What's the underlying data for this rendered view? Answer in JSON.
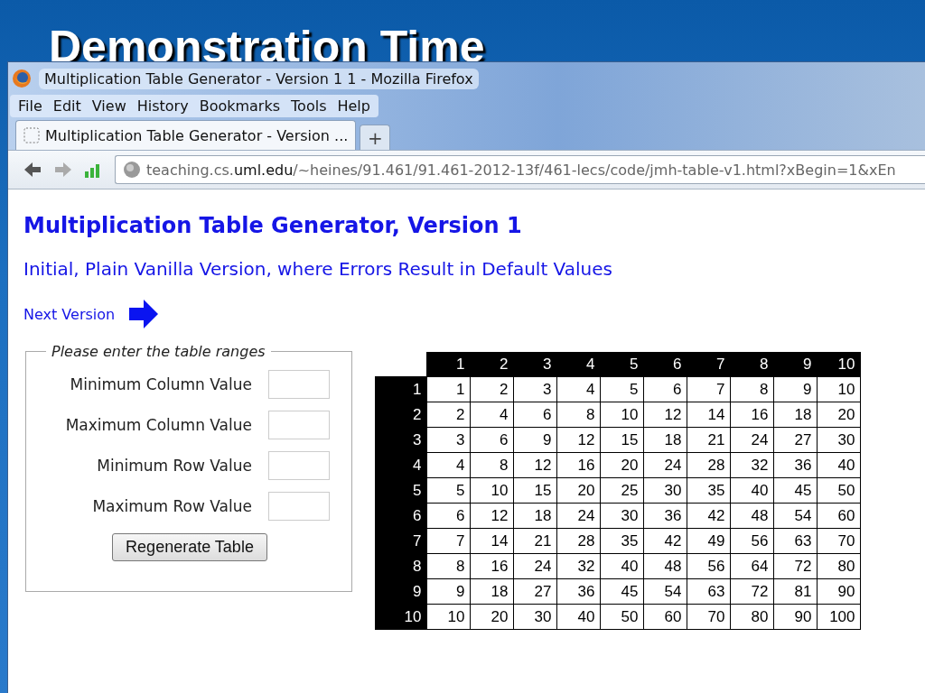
{
  "slide_title": "Demonstration Time",
  "window": {
    "title": "Multiplication Table Generator - Version 1 1 - Mozilla Firefox"
  },
  "menu": [
    "File",
    "Edit",
    "View",
    "History",
    "Bookmarks",
    "Tools",
    "Help"
  ],
  "tabs": [
    {
      "label": "Multiplication Table Generator - Version ...",
      "selected": true
    }
  ],
  "new_tab": "+",
  "address": {
    "pre": "teaching.cs.",
    "host": "uml.edu",
    "path": "/~heines/91.461/91.461-2012-13f/461-lecs/code/jmh-table-v1.html?xBegin=1&xEn"
  },
  "page": {
    "heading": "Multiplication Table Generator, Version 1",
    "subheading": "Initial, Plain Vanilla Version, where Errors Result in Default Values",
    "next_link": "Next Version"
  },
  "form": {
    "legend": "Please enter the table ranges",
    "fields": [
      "Minimum Column Value",
      "Maximum Column Value",
      "Minimum Row Value",
      "Maximum Row Value"
    ],
    "button": "Regenerate Table"
  },
  "table": {
    "columns": [
      "1",
      "2",
      "3",
      "4",
      "5",
      "6",
      "7",
      "8",
      "9",
      "10"
    ],
    "rows": [
      {
        "label": "1",
        "cells": [
          "1",
          "2",
          "3",
          "4",
          "5",
          "6",
          "7",
          "8",
          "9",
          "10"
        ]
      },
      {
        "label": "2",
        "cells": [
          "2",
          "4",
          "6",
          "8",
          "10",
          "12",
          "14",
          "16",
          "18",
          "20"
        ]
      },
      {
        "label": "3",
        "cells": [
          "3",
          "6",
          "9",
          "12",
          "15",
          "18",
          "21",
          "24",
          "27",
          "30"
        ]
      },
      {
        "label": "4",
        "cells": [
          "4",
          "8",
          "12",
          "16",
          "20",
          "24",
          "28",
          "32",
          "36",
          "40"
        ]
      },
      {
        "label": "5",
        "cells": [
          "5",
          "10",
          "15",
          "20",
          "25",
          "30",
          "35",
          "40",
          "45",
          "50"
        ]
      },
      {
        "label": "6",
        "cells": [
          "6",
          "12",
          "18",
          "24",
          "30",
          "36",
          "42",
          "48",
          "54",
          "60"
        ]
      },
      {
        "label": "7",
        "cells": [
          "7",
          "14",
          "21",
          "28",
          "35",
          "42",
          "49",
          "56",
          "63",
          "70"
        ]
      },
      {
        "label": "8",
        "cells": [
          "8",
          "16",
          "24",
          "32",
          "40",
          "48",
          "56",
          "64",
          "72",
          "80"
        ]
      },
      {
        "label": "9",
        "cells": [
          "9",
          "18",
          "27",
          "36",
          "45",
          "54",
          "63",
          "72",
          "81",
          "90"
        ]
      },
      {
        "label": "10",
        "cells": [
          "10",
          "20",
          "30",
          "40",
          "50",
          "60",
          "70",
          "80",
          "90",
          "100"
        ]
      }
    ]
  }
}
